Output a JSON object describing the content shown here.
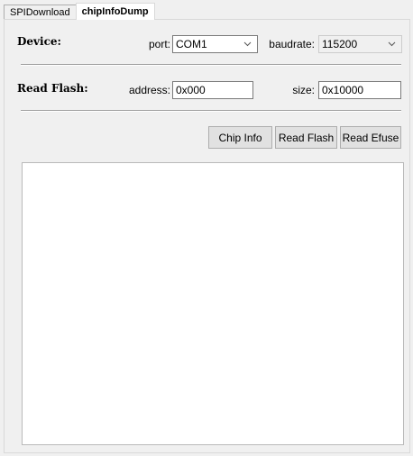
{
  "tabs": [
    {
      "label": "SPIDownload",
      "active": false
    },
    {
      "label": "chipInfoDump",
      "active": true
    }
  ],
  "device": {
    "section_label": "Device:",
    "port_label": "port:",
    "port_value": "COM1",
    "baudrate_label": "baudrate:",
    "baudrate_value": "115200"
  },
  "read_flash": {
    "section_label": "Read Flash:",
    "address_label": "address:",
    "address_value": "0x000",
    "size_label": "size:",
    "size_value": "0x10000"
  },
  "buttons": {
    "chip_info": "Chip Info",
    "read_flash": "Read Flash",
    "read_efuse": "Read Efuse"
  },
  "output": {
    "text": ""
  }
}
